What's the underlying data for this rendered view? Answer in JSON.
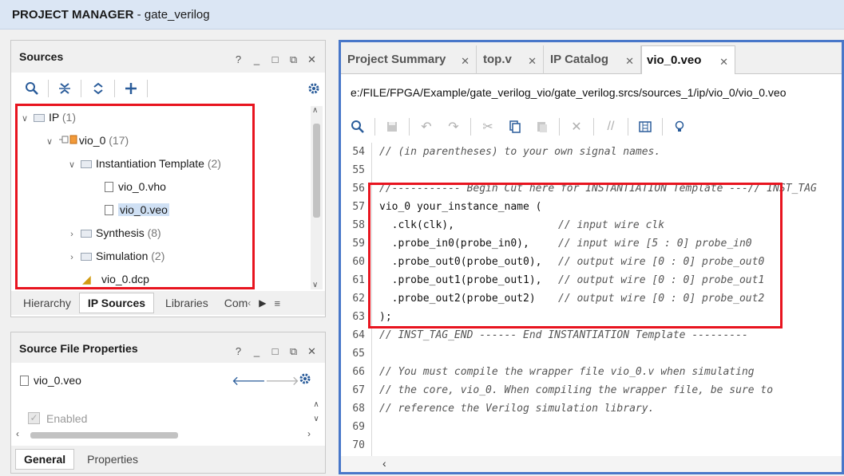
{
  "title": {
    "app": "PROJECT MANAGER",
    "sep": " - ",
    "project": "gate_verilog"
  },
  "sources": {
    "title": "Sources",
    "win_ctrls": [
      "?",
      "_",
      "□",
      "⧉",
      "✕"
    ],
    "tree": [
      {
        "label": "IP",
        "count": "(1)"
      },
      {
        "label": "vio_0",
        "count": "(17)"
      },
      {
        "label": "Instantiation Template",
        "count": "(2)"
      },
      {
        "label": "vio_0.vho",
        "count": ""
      },
      {
        "label": "vio_0.veo",
        "count": ""
      },
      {
        "label": "Synthesis",
        "count": "(8)"
      },
      {
        "label": "Simulation",
        "count": "(2)"
      },
      {
        "label": "vio_0.dcp",
        "count": ""
      }
    ],
    "tabs": [
      "Hierarchy",
      "IP Sources",
      "Libraries",
      "Com"
    ]
  },
  "props": {
    "title": "Source File Properties",
    "win_ctrls": [
      "?",
      "_",
      "□",
      "⧉",
      "✕"
    ],
    "file": "vio_0.veo",
    "enabled_label": "Enabled",
    "tabs": [
      "General",
      "Properties"
    ]
  },
  "editor": {
    "tabs": [
      {
        "label": "Project Summary"
      },
      {
        "label": "top.v"
      },
      {
        "label": "IP Catalog"
      },
      {
        "label": "vio_0.veo"
      }
    ],
    "path": "e:/FILE/FPGA/Example/gate_verilog_vio/gate_verilog.srcs/sources_1/ip/vio_0/vio_0.veo",
    "lines": [
      {
        "n": "54",
        "t": "// (in parentheses) to your own signal names.",
        "c": true
      },
      {
        "n": "55",
        "t": "",
        "c": false
      },
      {
        "n": "56",
        "t": "//----------- Begin Cut here for INSTANTIATION Template ---// INST_TAG",
        "c": true
      },
      {
        "n": "57",
        "t": "vio_0 your_instance_name (",
        "c": false
      },
      {
        "n": "58",
        "t": "  .clk(clk),",
        "c2": "// input wire clk"
      },
      {
        "n": "59",
        "t": "  .probe_in0(probe_in0),",
        "c2": "// input wire [5 : 0] probe_in0"
      },
      {
        "n": "60",
        "t": "  .probe_out0(probe_out0),",
        "c2": "// output wire [0 : 0] probe_out0"
      },
      {
        "n": "61",
        "t": "  .probe_out1(probe_out1),",
        "c2": "// output wire [0 : 0] probe_out1"
      },
      {
        "n": "62",
        "t": "  .probe_out2(probe_out2)",
        "c2": "// output wire [0 : 0] probe_out2"
      },
      {
        "n": "63",
        "t": ");",
        "c": false
      },
      {
        "n": "64",
        "t": "// INST_TAG_END ------ End INSTANTIATION Template ---------",
        "c": true
      },
      {
        "n": "65",
        "t": "",
        "c": false
      },
      {
        "n": "66",
        "t": "// You must compile the wrapper file vio_0.v when simulating",
        "c": true
      },
      {
        "n": "67",
        "t": "// the core, vio_0. When compiling the wrapper file, be sure to",
        "c": true
      },
      {
        "n": "68",
        "t": "// reference the Verilog simulation library.",
        "c": true
      },
      {
        "n": "69",
        "t": "",
        "c": false
      },
      {
        "n": "70",
        "t": "",
        "c": false
      }
    ]
  },
  "colors": {
    "highlight_box": "#e8141f",
    "editor_border": "#4877c9",
    "titlebar": "#dbe6f4"
  }
}
